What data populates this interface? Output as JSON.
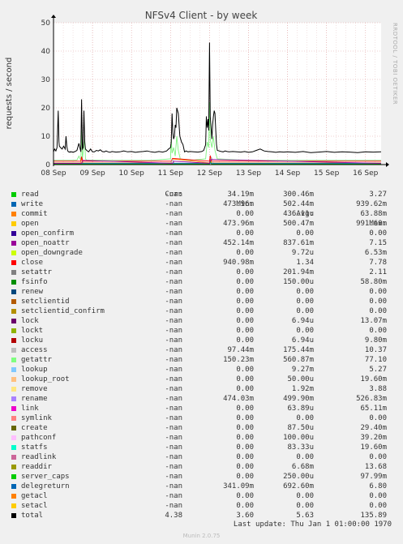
{
  "chart_data": {
    "type": "line",
    "title": "NFSv4 Client - by week",
    "ylabel": "requests / second",
    "ylim": [
      0,
      50
    ],
    "yticks": [
      "0",
      "10",
      "20",
      "30",
      "40",
      "50"
    ],
    "xticks": [
      "08 Sep",
      "09 Sep",
      "10 Sep",
      "11 Sep",
      "12 Sep",
      "13 Sep",
      "14 Sep",
      "15 Sep",
      "16 Sep"
    ],
    "grid": true,
    "series": [
      {
        "name": "total",
        "color": "#000000",
        "x": [
          0,
          0.03,
          0.06,
          0.09,
          0.1,
          0.12,
          0.14,
          0.15,
          0.18,
          0.22,
          0.26,
          0.3,
          0.32,
          0.34,
          0.36,
          0.38,
          0.4,
          0.42,
          0.44,
          0.46,
          0.48,
          0.5,
          0.55,
          0.6,
          0.65,
          0.7,
          0.72,
          0.74,
          0.76,
          0.78,
          0.8,
          0.82,
          0.85,
          0.9,
          0.95,
          1.0,
          1.05,
          1.1,
          1.15,
          1.2,
          1.25,
          1.3,
          1.35,
          1.4,
          1.45,
          1.5,
          1.6,
          1.7,
          1.8,
          1.9,
          2.0,
          2.1,
          2.2,
          2.3,
          2.4,
          2.5,
          2.6,
          2.7,
          2.8,
          2.9,
          2.95,
          3.0,
          3.02,
          3.04,
          3.06,
          3.08,
          3.1,
          3.12,
          3.14,
          3.16,
          3.2,
          3.24,
          3.28,
          3.32,
          3.36,
          3.4,
          3.45,
          3.5,
          3.6,
          3.7,
          3.8,
          3.85,
          3.9,
          3.92,
          3.94,
          3.96,
          3.98,
          4.0,
          4.02,
          4.04,
          4.06,
          4.08,
          4.1,
          4.12,
          4.14,
          4.16,
          4.18,
          4.2,
          4.25,
          4.3,
          4.35,
          4.4,
          4.45,
          4.5,
          4.6,
          4.7,
          4.8,
          4.9,
          5.0,
          5.1,
          5.2,
          5.3,
          5.4,
          5.5,
          5.6,
          5.7,
          5.8,
          5.9,
          6.0,
          6.2,
          6.4,
          6.6,
          6.8,
          7.0,
          7.2,
          7.4,
          7.6,
          7.8,
          8.0,
          8.2,
          8.4
        ],
        "y": [
          4.5,
          5.5,
          4.8,
          6.0,
          10,
          19,
          8,
          6.5,
          6,
          5.5,
          6.5,
          5.5,
          10,
          6.5,
          5,
          4.5,
          4.5,
          4.3,
          4.6,
          4.4,
          4.5,
          4.3,
          4.6,
          5,
          7.5,
          4.5,
          23,
          5.5,
          6,
          19,
          8,
          5.5,
          5,
          4.5,
          5.5,
          4.5,
          4.5,
          5,
          4.8,
          5.2,
          4.6,
          4.5,
          4.8,
          4.5,
          4.3,
          4.6,
          4.4,
          4.5,
          4.8,
          4.5,
          4.6,
          4.3,
          4.5,
          4.6,
          4.8,
          4.5,
          4.3,
          4.6,
          4.4,
          4.8,
          5.5,
          6,
          8,
          18,
          11,
          9,
          10,
          14,
          13,
          20,
          18,
          10,
          8,
          7,
          4.5,
          4.8,
          4.5,
          4.6,
          4.5,
          4.4,
          4.6,
          5,
          7,
          17,
          13,
          16,
          12,
          43,
          17,
          13,
          9,
          14,
          17,
          19,
          18,
          12,
          7,
          5,
          4.8,
          4.6,
          4.5,
          4.8,
          4.6,
          4.5,
          4.6,
          4.5,
          4.4,
          4.6,
          4.3,
          4.5,
          5,
          5.5,
          4.8,
          4.6,
          4.5,
          4.3,
          4.5,
          4.4,
          4.5,
          4.3,
          4.6,
          4.2,
          4.4,
          4.6,
          4.3,
          4.5,
          4.4,
          4.2,
          4.5,
          4.4,
          4.5
        ]
      },
      {
        "name": "getattr",
        "color": "#7ef27e",
        "x": [
          0,
          0.5,
          0.6,
          0.65,
          0.7,
          0.72,
          0.74,
          0.8,
          0.82,
          0.85,
          1.5,
          2.5,
          3.0,
          3.02,
          3.04,
          3.08,
          3.12,
          3.16,
          3.2,
          3.25,
          3.5,
          3.9,
          3.94,
          3.98,
          4.0,
          4.02,
          4.06,
          4.1,
          4.14,
          4.2,
          5.0,
          6.0,
          7.0,
          8.4
        ],
        "y": [
          1.5,
          1.5,
          1.6,
          3,
          1.5,
          12,
          2,
          9,
          2,
          1.6,
          1.5,
          1.5,
          2,
          9,
          4,
          6,
          3,
          10,
          5,
          2,
          1.5,
          2,
          8,
          6,
          22,
          9,
          6,
          10,
          5,
          2,
          1.5,
          1.5,
          1.5,
          1.5
        ]
      },
      {
        "name": "open",
        "color": "#ff8000",
        "x": [
          0,
          0.7,
          0.72,
          0.75,
          3.02,
          3.05,
          4.0,
          4.02,
          4.05,
          8.4
        ],
        "y": [
          0.6,
          0.6,
          2.5,
          0.6,
          0.6,
          2,
          0.6,
          3,
          0.6,
          0.6
        ]
      },
      {
        "name": "close",
        "color": "#ff0000",
        "x": [
          0,
          0.7,
          0.72,
          0.75,
          3.02,
          3.05,
          4.0,
          4.02,
          4.05,
          8.4
        ],
        "y": [
          1.2,
          1.2,
          2.8,
          1.2,
          1.2,
          2.2,
          1.2,
          3.2,
          1.2,
          1.2
        ]
      },
      {
        "name": "access",
        "color": "#b0b0b0",
        "x": [
          0,
          3.0,
          3.05,
          3.1,
          4.0,
          4.05,
          4.1,
          8.4
        ],
        "y": [
          0.3,
          0.3,
          1.8,
          0.3,
          0.3,
          2.5,
          0.3,
          0.3
        ]
      },
      {
        "name": "read",
        "color": "#00cc00",
        "x": [
          0,
          4.0,
          4.02,
          4.05,
          8.4
        ],
        "y": [
          0.2,
          0.2,
          1.2,
          0.2,
          0.2
        ]
      },
      {
        "name": "write",
        "color": "#0066b3",
        "x": [
          0,
          8.4
        ],
        "y": [
          0.5,
          0.5
        ]
      },
      {
        "name": "open_noattr",
        "color": "#990099",
        "x": [
          0,
          0.72,
          0.75,
          3.05,
          3.08,
          4.0,
          4.03,
          8.4
        ],
        "y": [
          0.45,
          0.45,
          1.5,
          0.45,
          1.2,
          0.45,
          1.8,
          0.45
        ]
      }
    ]
  },
  "legend": {
    "headers": {
      "cur": "Cur:",
      "min": "Min:",
      "avg": "Avg:",
      "max": "Max:"
    },
    "rows": [
      {
        "name": "read",
        "color": "#00cc00",
        "cur": "-nan",
        "min": "34.19m",
        "avg": "300.46m",
        "max": "3.27"
      },
      {
        "name": "write",
        "color": "#0066b3",
        "cur": "-nan",
        "min": "473.96m",
        "avg": "502.44m",
        "max": "939.62m"
      },
      {
        "name": "commit",
        "color": "#ff8000",
        "cur": "-nan",
        "min": "0.00",
        "avg": "436.11u",
        "max": "63.88m"
      },
      {
        "name": "open",
        "color": "#ffcc00",
        "cur": "-nan",
        "min": "473.96m",
        "avg": "500.47m",
        "max": "991.60m"
      },
      {
        "name": "open_confirm",
        "color": "#330099",
        "cur": "-nan",
        "min": "0.00",
        "avg": "0.00",
        "max": "0.00"
      },
      {
        "name": "open_noattr",
        "color": "#990099",
        "cur": "-nan",
        "min": "452.14m",
        "avg": "837.61m",
        "max": "7.15"
      },
      {
        "name": "open_downgrade",
        "color": "#ccff00",
        "cur": "-nan",
        "min": "0.00",
        "avg": "9.72u",
        "max": "6.53m"
      },
      {
        "name": "close",
        "color": "#ff0000",
        "cur": "-nan",
        "min": "940.98m",
        "avg": "1.34",
        "max": "7.78"
      },
      {
        "name": "setattr",
        "color": "#808080",
        "cur": "-nan",
        "min": "0.00",
        "avg": "201.94m",
        "max": "2.11"
      },
      {
        "name": "fsinfo",
        "color": "#008f00",
        "cur": "-nan",
        "min": "0.00",
        "avg": "150.00u",
        "max": "58.80m"
      },
      {
        "name": "renew",
        "color": "#00487d",
        "cur": "-nan",
        "min": "0.00",
        "avg": "0.00",
        "max": "0.00"
      },
      {
        "name": "setclientid",
        "color": "#b35a00",
        "cur": "-nan",
        "min": "0.00",
        "avg": "0.00",
        "max": "0.00"
      },
      {
        "name": "setclientid_confirm",
        "color": "#b38f00",
        "cur": "-nan",
        "min": "0.00",
        "avg": "0.00",
        "max": "0.00"
      },
      {
        "name": "lock",
        "color": "#6b006b",
        "cur": "-nan",
        "min": "0.00",
        "avg": "6.94u",
        "max": "13.07m"
      },
      {
        "name": "lockt",
        "color": "#8fb300",
        "cur": "-nan",
        "min": "0.00",
        "avg": "0.00",
        "max": "0.00"
      },
      {
        "name": "locku",
        "color": "#b30000",
        "cur": "-nan",
        "min": "0.00",
        "avg": "6.94u",
        "max": "9.80m"
      },
      {
        "name": "access",
        "color": "#bebebe",
        "cur": "-nan",
        "min": "97.44m",
        "avg": "175.44m",
        "max": "10.37"
      },
      {
        "name": "getattr",
        "color": "#80ff80",
        "cur": "-nan",
        "min": "150.23m",
        "avg": "560.87m",
        "max": "77.10"
      },
      {
        "name": "lookup",
        "color": "#80c9ff",
        "cur": "-nan",
        "min": "0.00",
        "avg": "9.27m",
        "max": "5.27"
      },
      {
        "name": "lookup_root",
        "color": "#ffc080",
        "cur": "-nan",
        "min": "0.00",
        "avg": "50.00u",
        "max": "19.60m"
      },
      {
        "name": "remove",
        "color": "#ffe680",
        "cur": "-nan",
        "min": "0.00",
        "avg": "1.92m",
        "max": "3.88"
      },
      {
        "name": "rename",
        "color": "#aa80ff",
        "cur": "-nan",
        "min": "474.03m",
        "avg": "499.90m",
        "max": "526.83m"
      },
      {
        "name": "link",
        "color": "#ee00cc",
        "cur": "-nan",
        "min": "0.00",
        "avg": "63.89u",
        "max": "65.11m"
      },
      {
        "name": "symlink",
        "color": "#ff8080",
        "cur": "-nan",
        "min": "0.00",
        "avg": "0.00",
        "max": "0.00"
      },
      {
        "name": "create",
        "color": "#666600",
        "cur": "-nan",
        "min": "0.00",
        "avg": "87.50u",
        "max": "29.40m"
      },
      {
        "name": "pathconf",
        "color": "#ffbfff",
        "cur": "-nan",
        "min": "0.00",
        "avg": "100.00u",
        "max": "39.20m"
      },
      {
        "name": "statfs",
        "color": "#00ffcc",
        "cur": "-nan",
        "min": "0.00",
        "avg": "83.33u",
        "max": "19.60m"
      },
      {
        "name": "readlink",
        "color": "#cc6699",
        "cur": "-nan",
        "min": "0.00",
        "avg": "0.00",
        "max": "0.00"
      },
      {
        "name": "readdir",
        "color": "#999900",
        "cur": "-nan",
        "min": "0.00",
        "avg": "6.68m",
        "max": "13.68"
      },
      {
        "name": "server_caps",
        "color": "#00cc00",
        "cur": "-nan",
        "min": "0.00",
        "avg": "250.00u",
        "max": "97.99m"
      },
      {
        "name": "delegreturn",
        "color": "#0066b3",
        "cur": "-nan",
        "min": "341.09m",
        "avg": "692.60m",
        "max": "6.80"
      },
      {
        "name": "getacl",
        "color": "#ff8000",
        "cur": "-nan",
        "min": "0.00",
        "avg": "0.00",
        "max": "0.00"
      },
      {
        "name": "setacl",
        "color": "#ffcc00",
        "cur": "-nan",
        "min": "0.00",
        "avg": "0.00",
        "max": "0.00"
      },
      {
        "name": "total",
        "color": "#000000",
        "cur": "4.38",
        "min": "3.60",
        "avg": "5.63",
        "max": "135.89"
      }
    ]
  },
  "side_label": "RRDTOOL / TOBI OETIKER",
  "last_update": "Last update: Thu Jan  1 01:00:00 1970",
  "footer": "Munin 2.0.75"
}
